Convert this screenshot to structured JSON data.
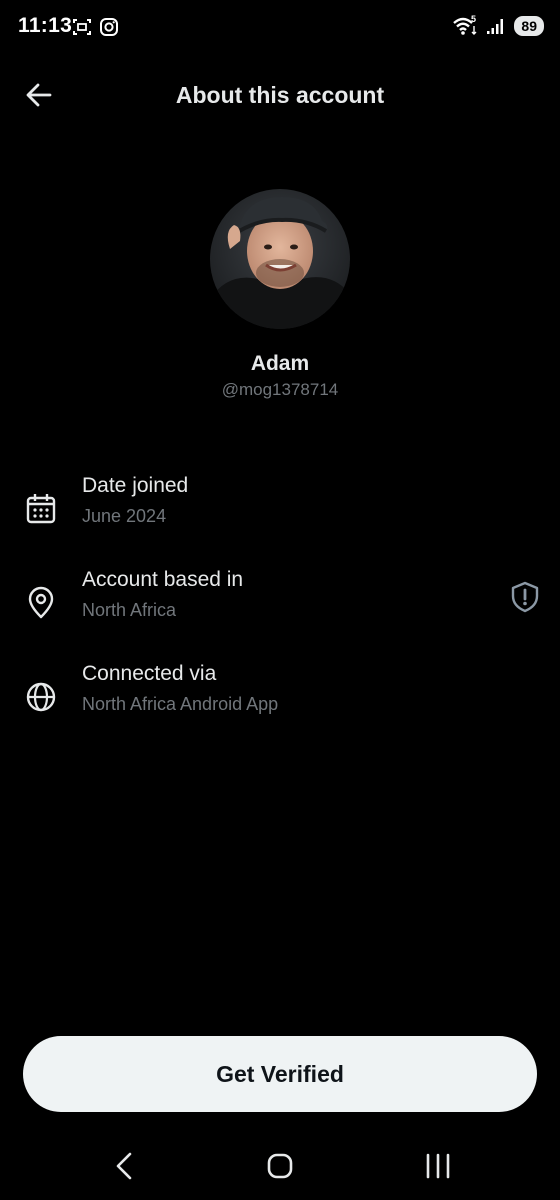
{
  "status_bar": {
    "time": "11:13",
    "battery": "89",
    "left_icons": [
      "screenshot-icon",
      "instagram-icon"
    ],
    "right_icons": [
      "wifi-icon",
      "signal-icon",
      "battery-icon"
    ],
    "network_badge": "5"
  },
  "header": {
    "title": "About this account",
    "back_icon": "arrow-left-icon"
  },
  "profile": {
    "name": "Adam",
    "handle": "@mog1378714"
  },
  "details": {
    "date_joined": {
      "label": "Date joined",
      "value": "June 2024",
      "icon": "calendar-icon"
    },
    "based_in": {
      "label": "Account based in",
      "value": "North Africa",
      "icon": "location-pin-icon",
      "trailing_icon": "shield-icon"
    },
    "connected_via": {
      "label": "Connected via",
      "value": "North Africa Android App",
      "icon": "globe-icon"
    }
  },
  "cta": {
    "label": "Get Verified"
  },
  "nav": [
    "back-nav-icon",
    "home-nav-icon",
    "recents-nav-icon"
  ],
  "colors": {
    "background": "#000000",
    "primary_text": "#e7e9ea",
    "secondary_text": "#71767b",
    "button_bg": "#eff3f4",
    "button_text": "#0f1419"
  }
}
